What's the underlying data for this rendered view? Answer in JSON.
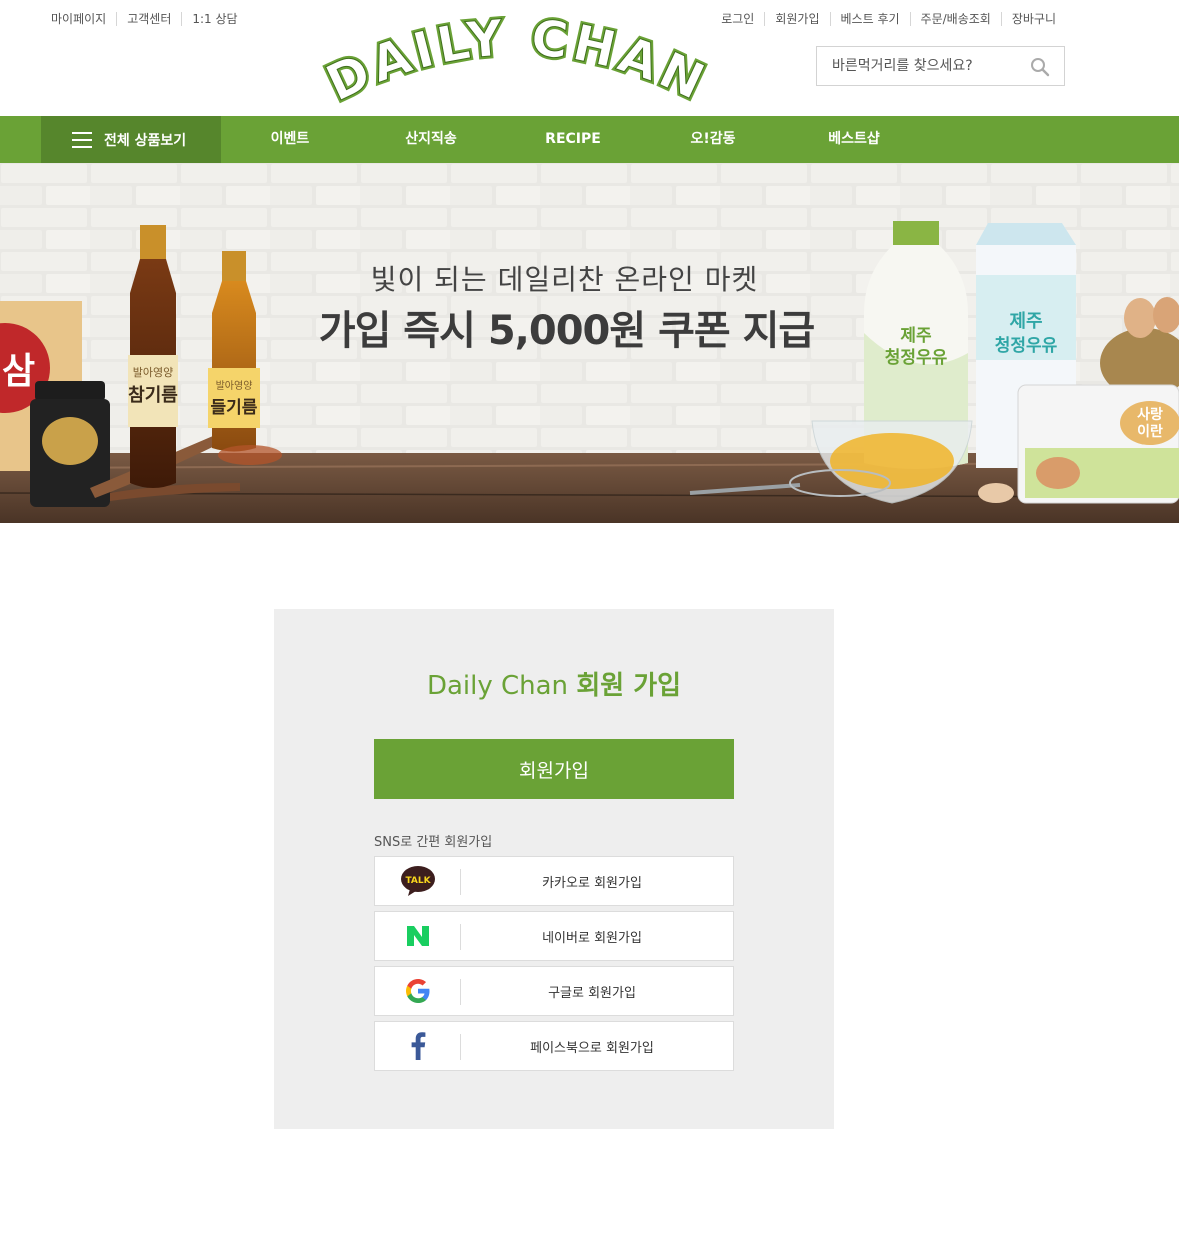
{
  "utility_left": [
    "마이페이지",
    "고객센터",
    "1:1 상담"
  ],
  "utility_right": [
    "로그인",
    "회원가입",
    "베스트 후기",
    "주문/배송조회",
    "장바구니"
  ],
  "logo": {
    "text": "DAILY CHAN",
    "color": "#6aa236"
  },
  "search": {
    "placeholder": "바른먹거리를 찾으세요?",
    "icon": "search-icon"
  },
  "nav": {
    "all_label": "전체 상품보기",
    "items": [
      "이벤트",
      "산지직송",
      "RECIPE",
      "오!감동",
      "베스트샵"
    ]
  },
  "banner": {
    "subtitle": "빛이 되는 데일리찬 온라인 마켓",
    "title": "가입 즉시 5,000원 쿠폰 지급",
    "product_labels": {
      "sesame_oil": "참기름",
      "perilla_oil": "들기름",
      "brand_left": "발아영양",
      "milk_left": "제주\n청정우유",
      "milk_right_1": "제주",
      "milk_right_2": "청정우유",
      "ginseng": "삼",
      "egg_box": "사랑\n이란"
    }
  },
  "signup": {
    "title_brand": "Daily Chan",
    "title_rest": "회원 가입",
    "button_label": "회원가입",
    "sns_label": "SNS로 간편 회원가입",
    "sns_buttons": [
      {
        "label": "카카오로 회원가입",
        "icon": "kakao-talk-icon"
      },
      {
        "label": "네이버로 회원가입",
        "icon": "naver-icon"
      },
      {
        "label": "구글로 회원가입",
        "icon": "google-icon"
      },
      {
        "label": "페이스북으로 회원가입",
        "icon": "facebook-icon"
      }
    ]
  },
  "colors": {
    "accent": "#6aa236",
    "accent_dark": "#56862c",
    "card_bg": "#eeeeee"
  }
}
